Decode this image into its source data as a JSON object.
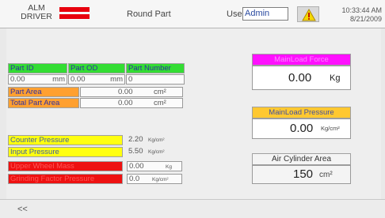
{
  "header": {
    "alarm_driver_line1": "ALM",
    "alarm_driver_line2": "DRIVER",
    "title": "Round Part",
    "user_label": "User",
    "user_value": "Admin",
    "time": "10:33:44 AM",
    "date": "8/21/2009"
  },
  "part_table": {
    "headers": [
      "Part ID",
      "Part OD",
      "Part Number"
    ],
    "part_id_value": "0.00",
    "part_id_unit": "mm",
    "part_od_value": "0.00",
    "part_od_unit": "mm",
    "part_number_value": "0"
  },
  "area": {
    "part_area_label": "Part Area",
    "part_area_value": "0.00",
    "part_area_unit": "cm²",
    "total_area_label": "Total Part Area",
    "total_area_value": "0.00",
    "total_area_unit": "cm²"
  },
  "pressures": {
    "counter_label": "Counter Pressure",
    "counter_value": "2.20",
    "counter_unit": "Kg/cm²",
    "input_label": "Input Pressure",
    "input_value": "5.50",
    "input_unit": "Kg/cm²",
    "wheel_label": "Upper Wheel Mass",
    "wheel_value": "0.00",
    "wheel_unit": "Kg",
    "grinding_label": "Grinding Factor Pressure",
    "grinding_value": "0.0",
    "grinding_unit": "Kg/cm²"
  },
  "right_panels": {
    "mainload_force_label": "MainLoad Force",
    "mainload_force_value": "0.00",
    "mainload_force_unit": "Kg",
    "mainload_pressure_label": "MainLoad Pressure",
    "mainload_pressure_value": "0.00",
    "mainload_pressure_unit": "Kg/cm²",
    "cylinder_area_label": "Air Cylinder Area",
    "cylinder_area_value": "150",
    "cylinder_area_unit": "cm²"
  },
  "footer": {
    "back_label": "<<"
  },
  "colors": {
    "alarm_red": "#e8000d",
    "header_green": "#33dd33",
    "header_orange": "#ffa030",
    "header_yellow": "#ffff10",
    "header_red": "#ee1111",
    "header_magenta": "#ff10ff",
    "warning_yellow": "#f5d800"
  },
  "icons": {
    "alarm": "alarm-driver-icon",
    "warning": "warning-triangle-icon"
  }
}
